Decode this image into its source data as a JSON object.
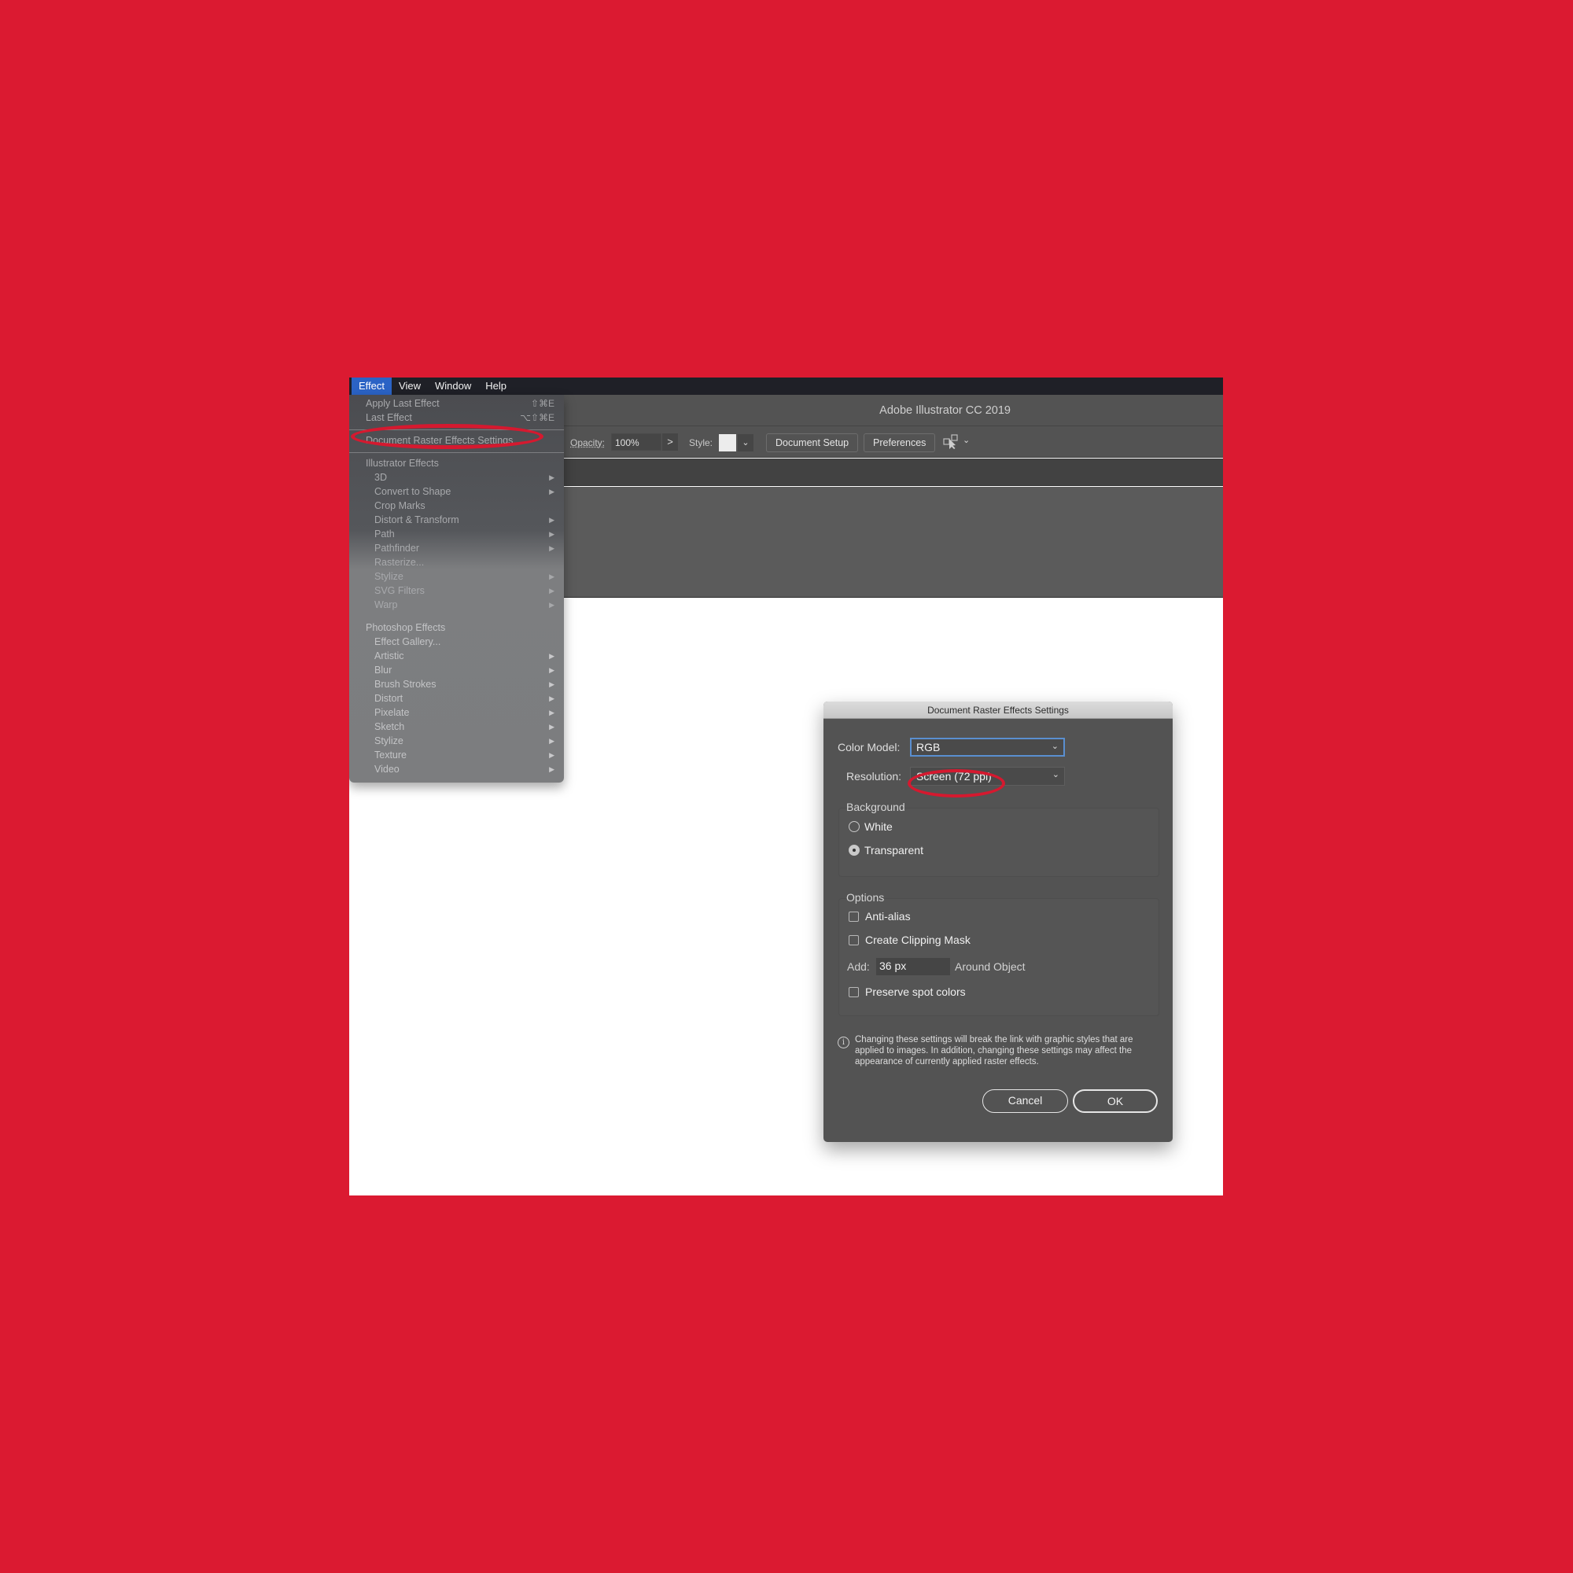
{
  "menubar": {
    "items": [
      "Effect",
      "View",
      "Window",
      "Help"
    ],
    "active": "Effect"
  },
  "app": {
    "title": "Adobe Illustrator CC 2019"
  },
  "controlbar": {
    "opacity_label": "Opacity:",
    "opacity_value": "100%",
    "opacity_more": ">",
    "style_label": "Style:",
    "style_dropdown": "⌄",
    "document_setup": "Document Setup",
    "preferences": "Preferences",
    "arrange_icon": "arrange-documents-icon",
    "arrange_dropdown": "⌄"
  },
  "effect_menu": {
    "apply_last": {
      "label": "Apply Last Effect",
      "shortcut": "⇧⌘E"
    },
    "last_effect": {
      "label": "Last Effect",
      "shortcut": "⌥⇧⌘E"
    },
    "raster_settings": "Document Raster Effects Settings...",
    "illustrator_header": "Illustrator Effects",
    "illustrator_items": [
      {
        "label": "3D",
        "submenu": true
      },
      {
        "label": "Convert to Shape",
        "submenu": true
      },
      {
        "label": "Crop Marks",
        "submenu": false
      },
      {
        "label": "Distort & Transform",
        "submenu": true
      },
      {
        "label": "Path",
        "submenu": true
      },
      {
        "label": "Pathfinder",
        "submenu": true
      },
      {
        "label": "Rasterize...",
        "submenu": false
      },
      {
        "label": "Stylize",
        "submenu": true
      },
      {
        "label": "SVG Filters",
        "submenu": true
      },
      {
        "label": "Warp",
        "submenu": true
      }
    ],
    "photoshop_header": "Photoshop Effects",
    "photoshop_items": [
      {
        "label": "Effect Gallery...",
        "submenu": false
      },
      {
        "label": "Artistic",
        "submenu": true
      },
      {
        "label": "Blur",
        "submenu": true
      },
      {
        "label": "Brush Strokes",
        "submenu": true
      },
      {
        "label": "Distort",
        "submenu": true
      },
      {
        "label": "Pixelate",
        "submenu": true
      },
      {
        "label": "Sketch",
        "submenu": true
      },
      {
        "label": "Stylize",
        "submenu": true
      },
      {
        "label": "Texture",
        "submenu": true
      },
      {
        "label": "Video",
        "submenu": true
      }
    ],
    "submenu_arrow": "▶"
  },
  "dialog": {
    "title": "Document Raster Effects Settings",
    "color_model_label": "Color Model:",
    "color_model_value": "RGB",
    "resolution_label": "Resolution:",
    "resolution_value": "Screen (72 ppi)",
    "chevron": "⌄",
    "background_title": "Background",
    "background_options": [
      {
        "label": "White",
        "selected": false
      },
      {
        "label": "Transparent",
        "selected": true
      }
    ],
    "options_title": "Options",
    "anti_alias": {
      "label": "Anti-alias",
      "checked": false
    },
    "clipping_mask": {
      "label": "Create Clipping Mask",
      "checked": false
    },
    "add_label": "Add:",
    "add_value": "36 px",
    "add_suffix": "Around Object",
    "preserve_spot": {
      "label": "Preserve spot colors",
      "checked": false
    },
    "info_icon": "i",
    "info_text": "Changing these settings will break the link with graphic styles that are applied to images. In addition, changing these settings may affect the appearance of currently applied raster effects.",
    "cancel": "Cancel",
    "ok": "OK"
  },
  "colors": {
    "background": "#db1a31",
    "highlight_ellipse": "#d5192f",
    "menu_active": "#2b63c5",
    "focus_ring": "#5a8fd0"
  }
}
